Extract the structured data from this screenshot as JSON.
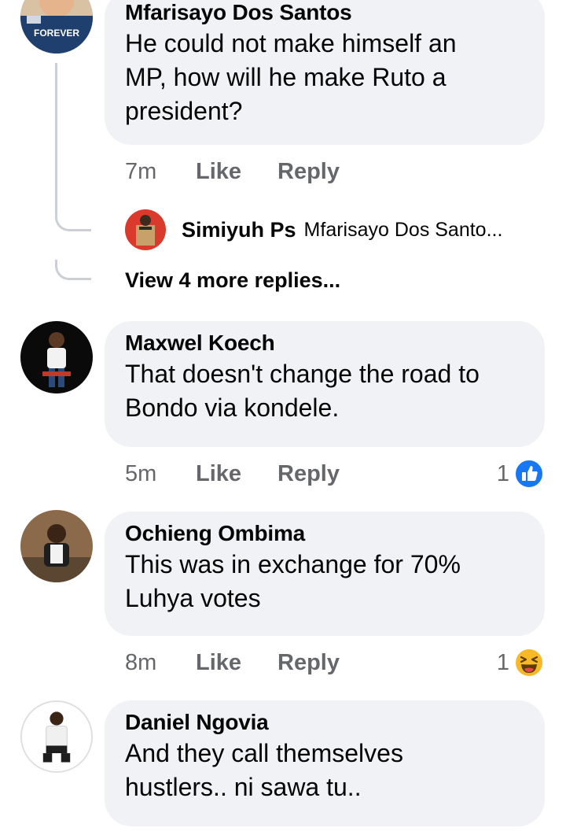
{
  "comments": [
    {
      "author": "Mfarisayo Dos Santos",
      "lines": [
        "He could not make himself an",
        "MP, how will he make Ruto a",
        "president?"
      ],
      "time": "7m",
      "like": "Like",
      "reply": "Reply",
      "avatar_badge": "FOREVER"
    },
    {
      "author": "Maxwel Koech",
      "lines": [
        "That doesn't change the road to",
        "Bondo via kondele."
      ],
      "time": "5m",
      "like": "Like",
      "reply": "Reply",
      "reaction_count": "1",
      "reaction_icon": "like-thumb-icon"
    },
    {
      "author": "Ochieng Ombima",
      "lines": [
        "This was in exchange for 70%",
        "Luhya votes"
      ],
      "time": "8m",
      "like": "Like",
      "reply": "Reply",
      "reaction_count": "1",
      "reaction_icon": "haha-emoji-icon"
    },
    {
      "author": "Daniel Ngovia",
      "lines": [
        "And they call themselves",
        "hustlers.. ni sawa tu.."
      ]
    }
  ],
  "reply_preview": {
    "author": "Simiyuh Ps",
    "snippet": "Mfarisayo Dos Santo..."
  },
  "view_more": "View 4 more replies...",
  "colors": {
    "bubble": "#f0f2f5",
    "meta": "#65676b",
    "like_blue": "#1877f2",
    "haha_yellow": "#f7b928",
    "thread_line": "#ccd0d5"
  }
}
